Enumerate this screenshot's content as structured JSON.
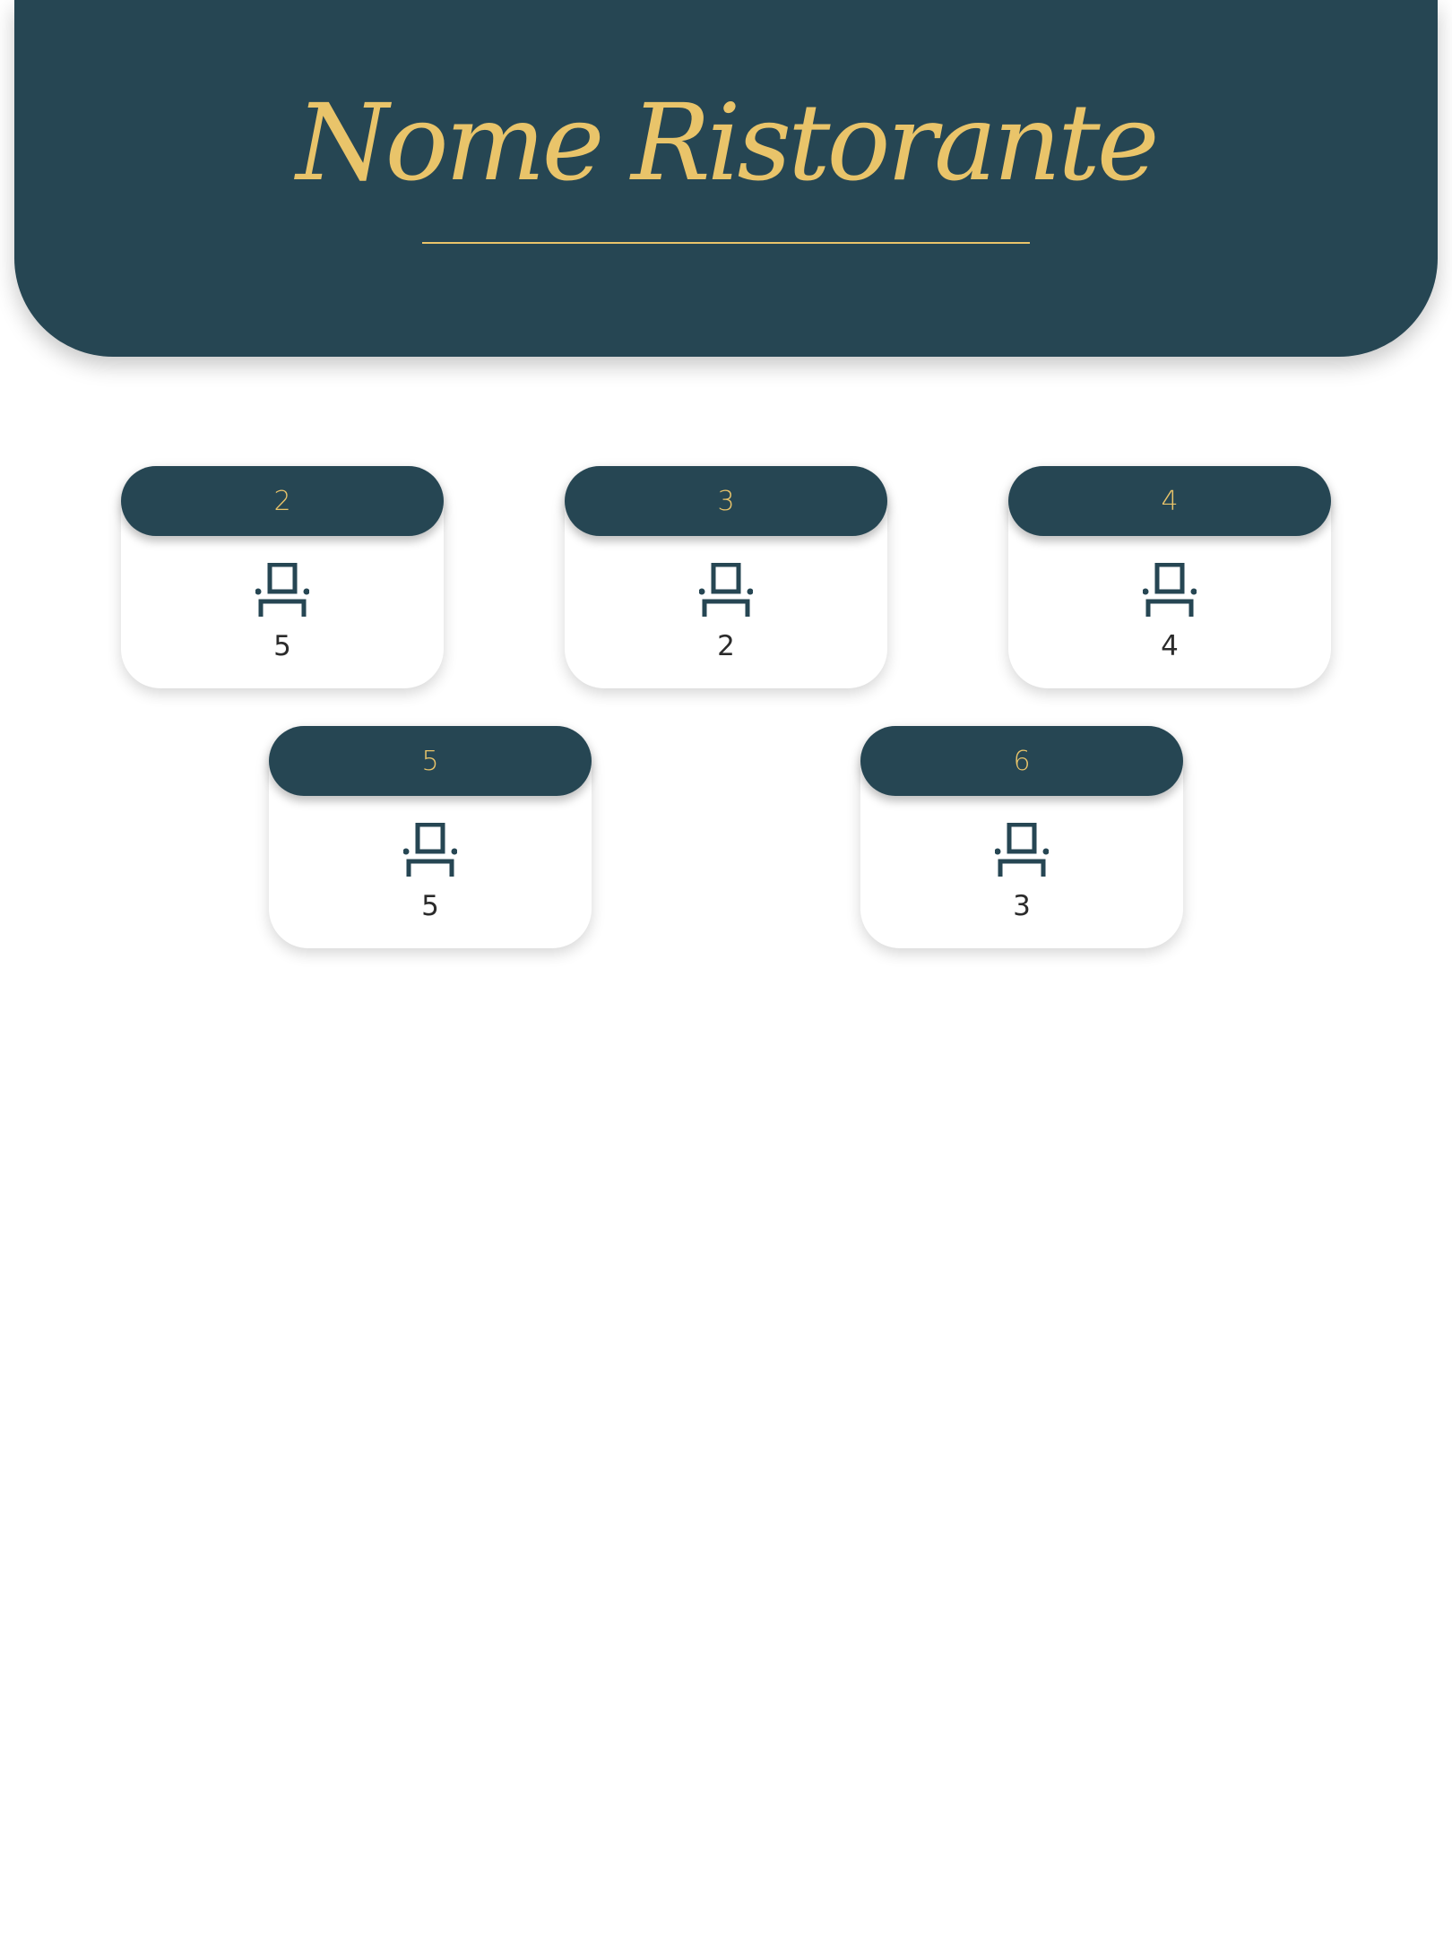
{
  "header": {
    "title": "Nome Ristorante"
  },
  "colors": {
    "primary": "#264653",
    "accent": "#e9c46a",
    "card_bg": "#ffffff"
  },
  "tables": [
    {
      "number": "2",
      "seats": "5",
      "icon": "chair-icon"
    },
    {
      "number": "3",
      "seats": "2",
      "icon": "chair-icon"
    },
    {
      "number": "4",
      "seats": "4",
      "icon": "chair-icon"
    },
    {
      "number": "5",
      "seats": "5",
      "icon": "chair-icon"
    },
    {
      "number": "6",
      "seats": "3",
      "icon": "chair-icon"
    }
  ]
}
